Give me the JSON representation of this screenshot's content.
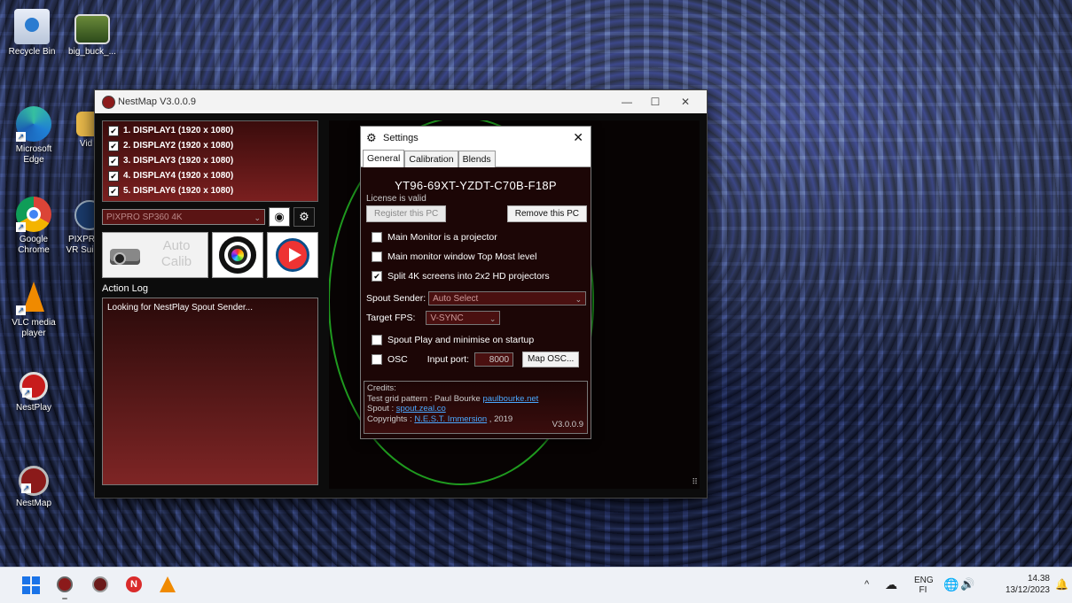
{
  "desktop": {
    "icons": [
      {
        "label": "Recycle Bin",
        "icon": "recycle-bin-icon"
      },
      {
        "label": "big_buck_...",
        "icon": "video-file-icon"
      },
      {
        "label": "Microsoft Edge",
        "icon": "edge-icon"
      },
      {
        "label": "Vid",
        "icon": "folder-icon"
      },
      {
        "label": "Google Chrome",
        "icon": "chrome-icon"
      },
      {
        "label": "PIXPR VR Sui",
        "icon": "pixpro-icon"
      },
      {
        "label": "VLC media player",
        "icon": "vlc-icon"
      },
      {
        "label": "NestPlay",
        "icon": "nestplay-icon"
      },
      {
        "label": "NestMap",
        "icon": "nestmap-icon"
      }
    ]
  },
  "nestmap": {
    "title": "NestMap V3.0.0.9",
    "displays": [
      {
        "label": "1. DISPLAY1 (1920 x 1080)",
        "checked": true
      },
      {
        "label": "2. DISPLAY2 (1920 x 1080)",
        "checked": true
      },
      {
        "label": "3. DISPLAY3 (1920 x 1080)",
        "checked": true
      },
      {
        "label": "4. DISPLAY4 (1920 x 1080)",
        "checked": true
      },
      {
        "label": "5. DISPLAY6 (1920 x 1080)",
        "checked": true
      }
    ],
    "camera_profile": "PIXPRO SP360 4K",
    "auto_calib_label": "Auto Calib",
    "action_log_label": "Action Log",
    "action_log_text": "Looking for NestPlay Spout Sender..."
  },
  "settings": {
    "title": "Settings",
    "tabs": [
      "General",
      "Calibration",
      "Blends"
    ],
    "active_tab": "General",
    "serial": "YT96-69XT-YZDT-C70B-F18P",
    "license_status": "License is valid",
    "register_btn": "Register this PC",
    "remove_btn": "Remove this PC",
    "options": [
      {
        "label": "Main Monitor is a projector",
        "checked": false
      },
      {
        "label": "Main monitor window Top Most level",
        "checked": false
      },
      {
        "label": "Split 4K screens into 2x2 HD projectors",
        "checked": true
      }
    ],
    "spout_sender_label": "Spout Sender:",
    "spout_sender_value": "Auto Select",
    "target_fps_label": "Target FPS:",
    "target_fps_value": "V-SYNC",
    "spout_play_option": {
      "label": "Spout Play and minimise on startup",
      "checked": false
    },
    "osc_option": {
      "label": "OSC",
      "checked": false
    },
    "input_port_label": "Input port:",
    "input_port_value": "8000",
    "map_osc_btn": "Map OSC...",
    "credits": {
      "heading": "Credits:",
      "line1_prefix": "Test grid pattern : Paul Bourke ",
      "line1_link": "paulbourke.net",
      "line2_prefix": "Spout : ",
      "line2_link": "spout.zeal.co",
      "line3_prefix": "Copyrights : ",
      "line3_link": "N.E.S.T. Immersion",
      "line3_suffix": " , 2019",
      "version": "V3.0.0.9"
    }
  },
  "taskbar": {
    "language_top": "ENG",
    "language_bottom": "FI",
    "time": "14.38",
    "date": "13/12/2023"
  },
  "colors": {
    "accent_green": "#1f9a1f",
    "panel_red": "#7a1f1f",
    "link_blue": "#4aa8ff"
  }
}
